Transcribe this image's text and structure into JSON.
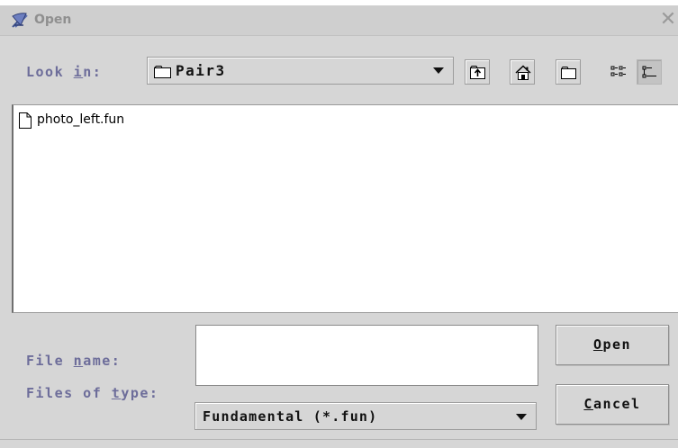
{
  "window": {
    "title": "Open",
    "close_glyph": "✕",
    "app_icon": "java-cup-icon"
  },
  "lookin": {
    "label_pre": "Look ",
    "label_mnemonic": "i",
    "label_post": "n:",
    "value": "Pair3"
  },
  "toolbar": {
    "buttons": [
      "up-folder-icon",
      "home-icon",
      "new-folder-icon",
      "list-view-icon",
      "details-view-icon"
    ]
  },
  "files": [
    {
      "name": "photo_left.fun",
      "icon": "file-icon"
    }
  ],
  "filename": {
    "label_pre": "File ",
    "label_mnemonic": "n",
    "label_post": "ame:",
    "value": ""
  },
  "filetype": {
    "label_pre": "Files of ",
    "label_mnemonic": "t",
    "label_post": "ype:",
    "value": "Fundamental (*.fun)"
  },
  "buttons": {
    "open_mnemonic": "O",
    "open_rest": "pen",
    "cancel_mnemonic": "C",
    "cancel_rest": "ancel"
  },
  "colors": {
    "dialog_bg": "#d6d6d6",
    "label": "#6d6d9a",
    "title": "#8f8f8f"
  }
}
